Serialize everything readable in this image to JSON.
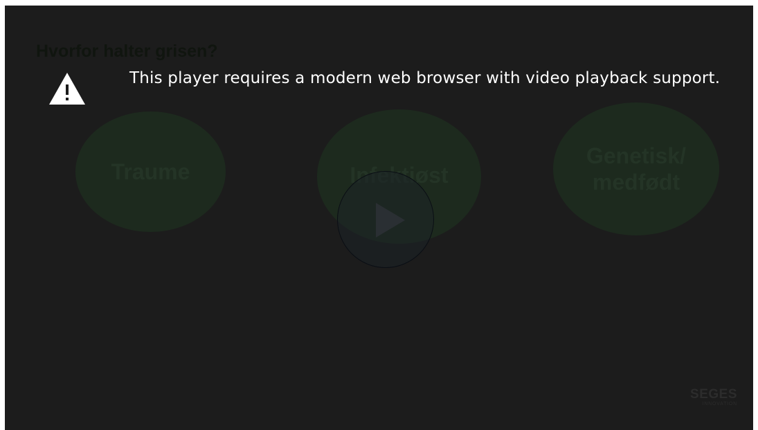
{
  "slide": {
    "title": "Hvorfor halter grisen?",
    "bubbles": [
      {
        "label": "Traume"
      },
      {
        "label": "Infektiøst"
      },
      {
        "label": "Genetisk/ medfødt"
      }
    ]
  },
  "warning": {
    "icon": "warning-triangle-icon",
    "message": "This player requires a modern web browser with video playback support."
  },
  "player": {
    "play_icon": "play-icon"
  },
  "brand": {
    "name": "SEGES",
    "subtitle": "INNOVATION"
  },
  "colors": {
    "background": "#1c1c1c",
    "warning_text": "#ffffff"
  }
}
